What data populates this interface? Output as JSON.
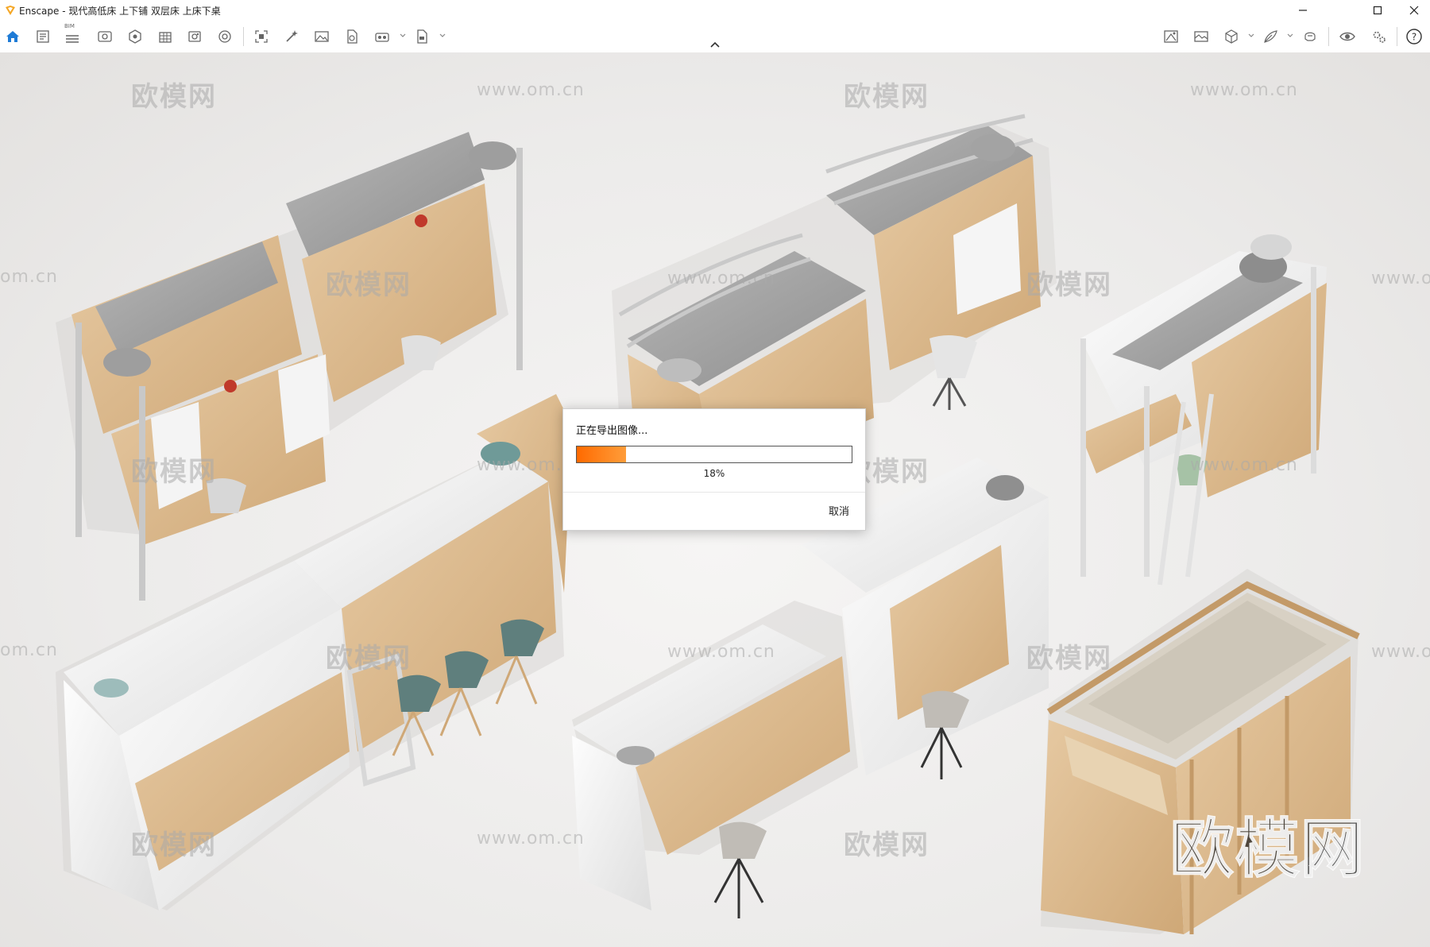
{
  "window": {
    "title": "Enscape - 现代高低床 上下铺 双层床 上床下桌",
    "accent_color": "#f5a623"
  },
  "toolbar": {
    "left_icons": [
      "home-icon",
      "document-icon",
      "bim-icon",
      "sun-icon",
      "view-icon",
      "material-icon",
      "building-icon",
      "photo-capture-icon",
      "vr-icon",
      "capture-icon",
      "batch-render-icon",
      "gallery-icon",
      "upload-icon",
      "export-icon",
      "export-exe-icon"
    ],
    "right_icons": [
      "panorama-icon",
      "image-icon",
      "cube-icon",
      "plant-icon",
      "vr-headset-icon",
      "eye-icon",
      "settings-icon",
      "help-icon"
    ],
    "bim_label": "BIM"
  },
  "watermarks": {
    "site_name": "欧模网",
    "site_url": "www.om.cn",
    "url_fragment": "om.cn"
  },
  "export_dialog": {
    "title": "正在导出图像...",
    "progress": 0.18,
    "progress_text": "18%",
    "cancel_label": "取消",
    "progress_color": "#ff7a14"
  }
}
